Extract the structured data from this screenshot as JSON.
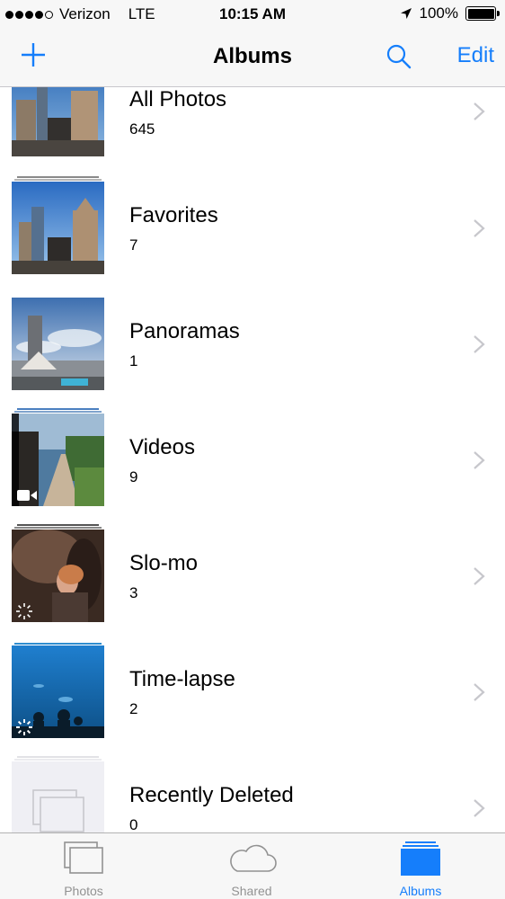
{
  "status_bar": {
    "carrier": "Verizon",
    "network": "LTE",
    "time": "10:15 AM",
    "battery": "100%",
    "signal_bars": 4,
    "signal_total": 5
  },
  "nav": {
    "title": "Albums",
    "edit_label": "Edit",
    "add_icon": "plus-icon",
    "search_icon": "search-icon",
    "accent_color": "#157efb"
  },
  "albums": [
    {
      "title": "All Photos",
      "count": "645"
    },
    {
      "title": "Favorites",
      "count": "7"
    },
    {
      "title": "Panoramas",
      "count": "1"
    },
    {
      "title": "Videos",
      "count": "9"
    },
    {
      "title": "Slo-mo",
      "count": "3"
    },
    {
      "title": "Time-lapse",
      "count": "2"
    },
    {
      "title": "Recently Deleted",
      "count": "0"
    }
  ],
  "tabs": [
    {
      "label": "Photos",
      "icon": "photos-icon",
      "active": false
    },
    {
      "label": "Shared",
      "icon": "cloud-icon",
      "active": false
    },
    {
      "label": "Albums",
      "icon": "albums-icon",
      "active": true
    }
  ]
}
